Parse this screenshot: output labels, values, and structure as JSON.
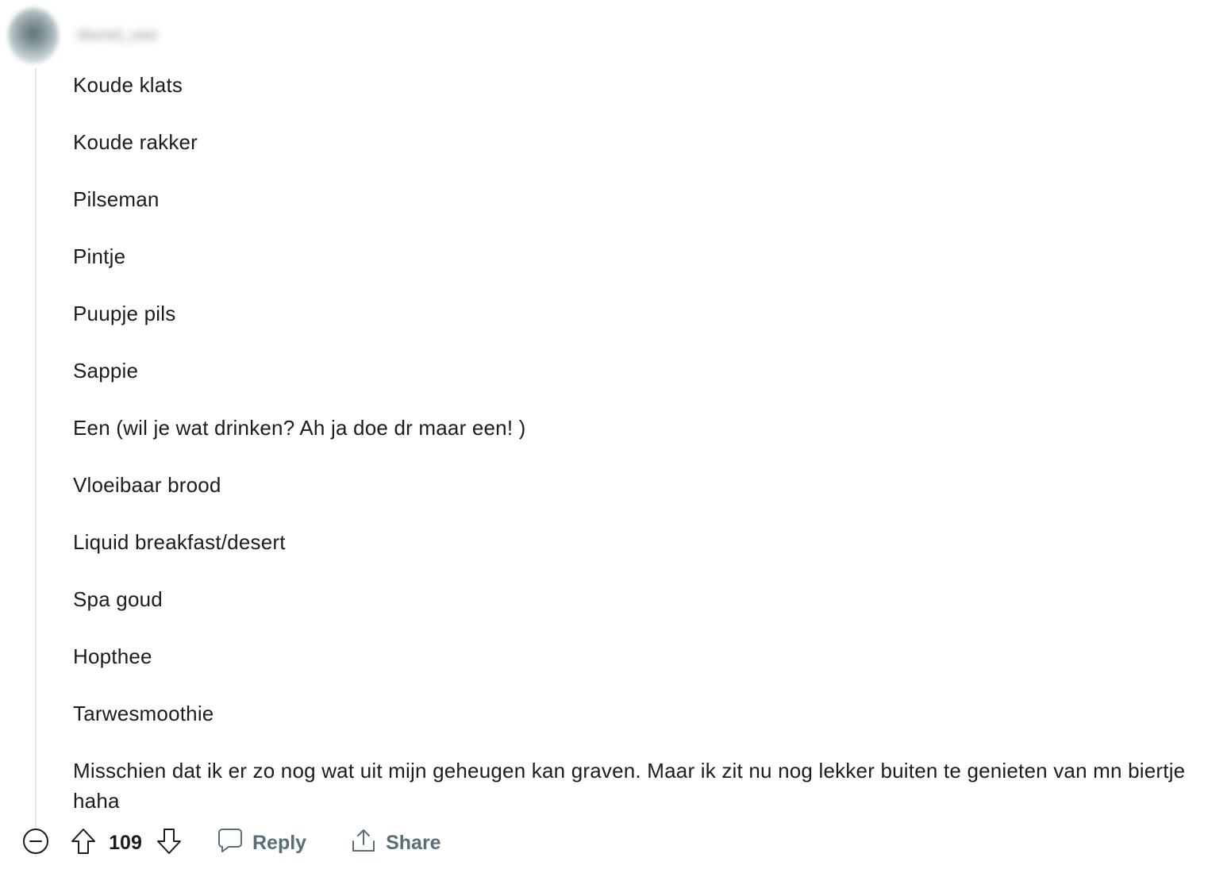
{
  "comment": {
    "author": "blurred_user",
    "lines": [
      "Koude klats",
      "Koude rakker",
      "Pilseman",
      "Pintje",
      "Puupje pils",
      "Sappie",
      "Een (wil je wat drinken? Ah ja doe dr maar een! )",
      "Vloeibaar brood",
      "Liquid breakfast/desert",
      "Spa goud",
      "Hopthee",
      "Tarwesmoothie",
      "Misschien dat ik er zo nog wat uit mijn geheugen kan graven. Maar ik zit nu nog lekker buiten te genieten van mn biertje haha"
    ]
  },
  "actions": {
    "collapse_icon": "collapse-minus-icon",
    "upvote_icon": "upvote-arrow-icon",
    "vote_count": "109",
    "downvote_icon": "downvote-arrow-icon",
    "reply_icon": "speech-bubble-icon",
    "reply_label": "Reply",
    "share_icon": "share-upload-icon",
    "share_label": "Share"
  },
  "colors": {
    "text": "#1c1c1c",
    "muted_action": "#576f76",
    "thread_line": "#e3e7e8"
  }
}
